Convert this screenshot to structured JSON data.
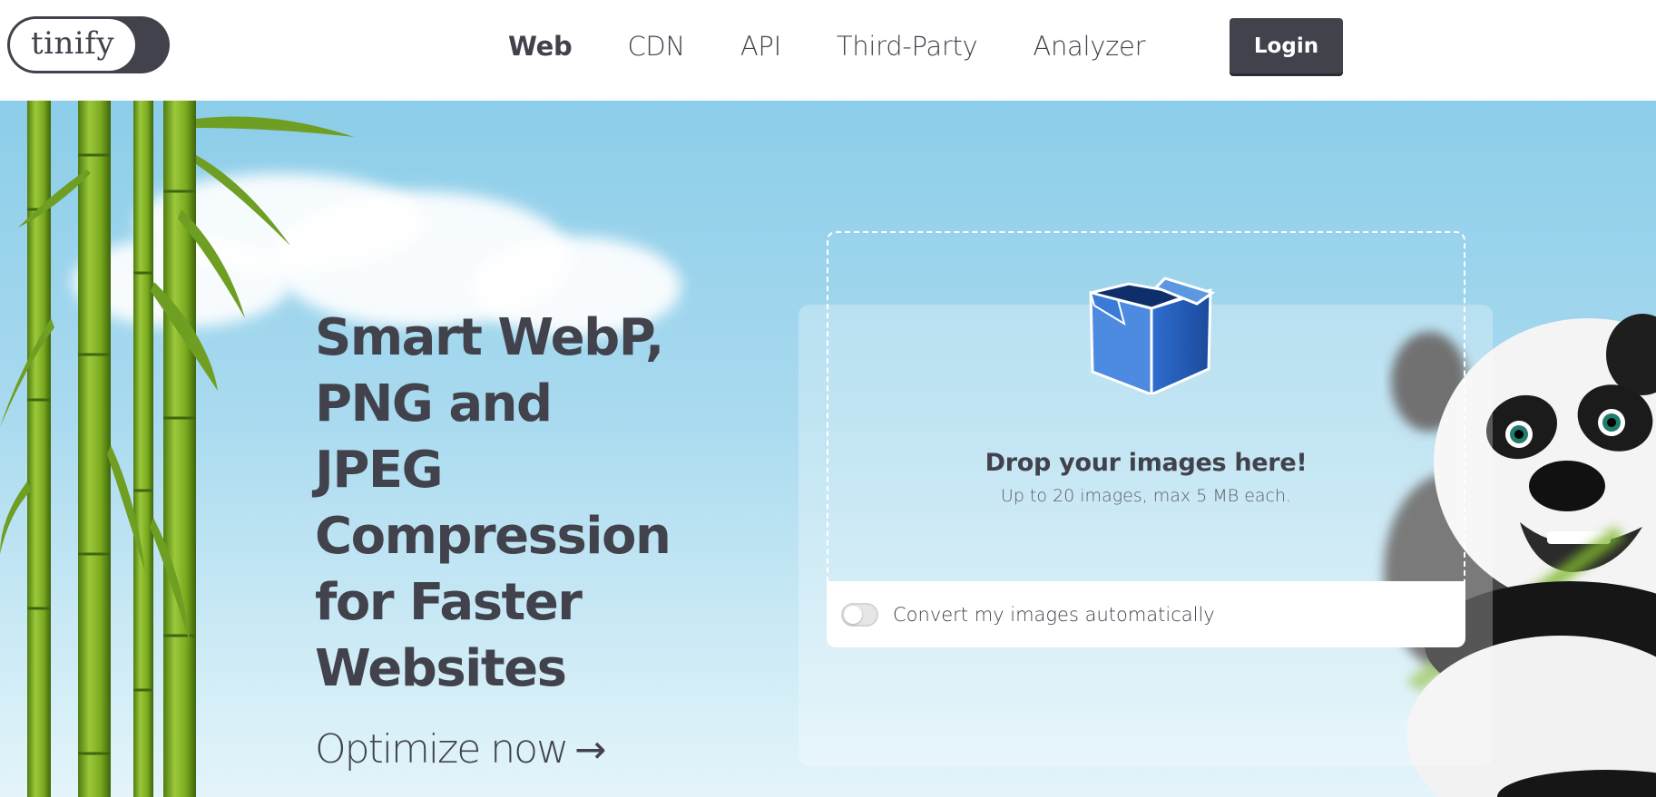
{
  "brand": {
    "logo_text": "tinify"
  },
  "nav": {
    "items": [
      {
        "label": "Web",
        "active": true
      },
      {
        "label": "CDN",
        "active": false
      },
      {
        "label": "API",
        "active": false
      },
      {
        "label": "Third-Party",
        "active": false
      },
      {
        "label": "Analyzer",
        "active": false
      }
    ],
    "login_label": "Login"
  },
  "hero": {
    "headline_lines": [
      "Smart WebP,",
      "PNG and",
      "JPEG",
      "Compression",
      "for Faster",
      "Websites"
    ],
    "cta_label": "Optimize now",
    "cta_arrow": "→"
  },
  "dropzone": {
    "title": "Drop your images here!",
    "subtitle": "Up to 20 images, max 5 MB each.",
    "toggle_label": "Convert my images automatically",
    "toggle_on": false
  },
  "colors": {
    "text": "#41424c",
    "button_bg": "#41424c",
    "sky_top": "#8ccde9",
    "sky_bottom": "#e4f4fa",
    "box_blue": "#2d64b8"
  },
  "icons": {
    "upload": "open-box-icon",
    "arrow": "arrow-right-icon"
  }
}
